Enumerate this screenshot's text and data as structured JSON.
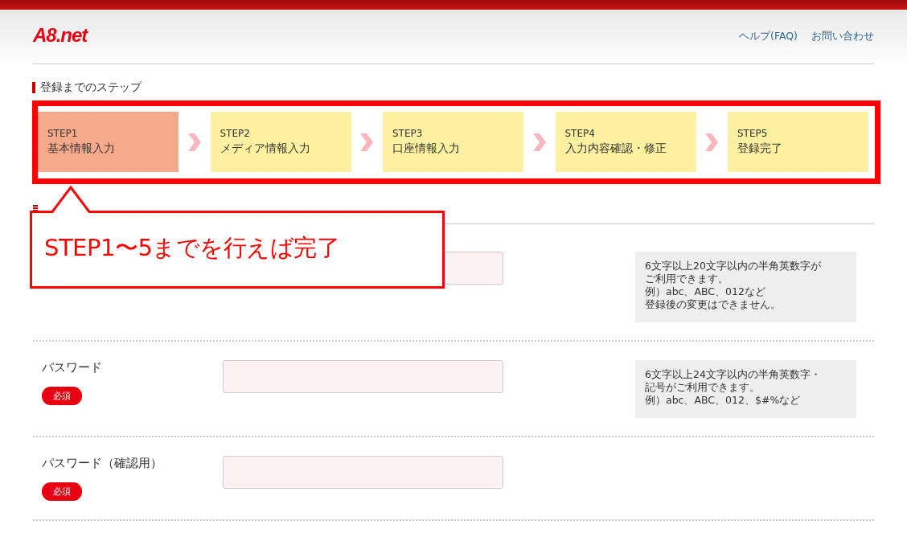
{
  "header": {
    "logo": "A8.net",
    "links": [
      "ヘルプ(FAQ)",
      "お問い合わせ"
    ]
  },
  "steps_section": {
    "title": "登録までのステップ",
    "steps": [
      {
        "number": "STEP1",
        "label": "基本情報入力",
        "selected": true
      },
      {
        "number": "STEP2",
        "label": "メディア情報入力",
        "selected": false
      },
      {
        "number": "STEP3",
        "label": "口座情報入力",
        "selected": false
      },
      {
        "number": "STEP4",
        "label": "入力内容確認・修正",
        "selected": false
      },
      {
        "number": "STEP5",
        "label": "登録完了",
        "selected": false
      }
    ]
  },
  "form": {
    "rows": [
      {
        "info": [
          "6文字以上20文字以内の半角英数字が",
          "ご利用できます。",
          "例）abc、ABC、012など",
          "登録後の変更はできません。"
        ]
      },
      {
        "label": "パスワード",
        "badge": "必須",
        "info": [
          "6文字以上24文字以内の半角英数字・",
          "記号がご利用できます。",
          "例）abc、ABC、012、$#%など"
        ]
      },
      {
        "label": "パスワード（確認用）",
        "badge": "必須"
      }
    ]
  },
  "callout": {
    "text": "STEP1〜5までを行えば完了"
  }
}
